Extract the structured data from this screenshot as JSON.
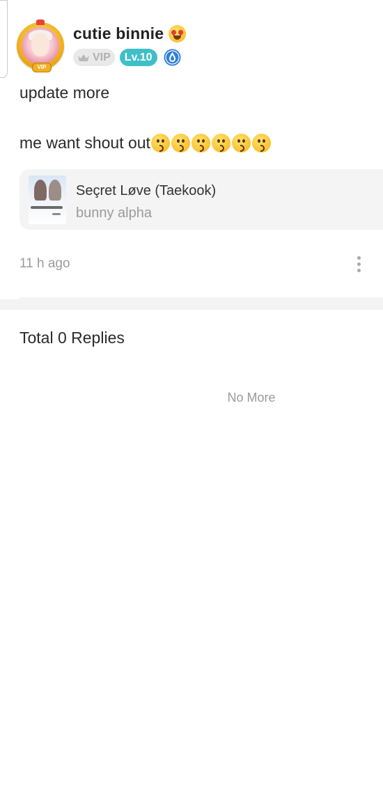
{
  "header": {
    "username": "cutie binnie",
    "vip_label": "VIP",
    "level_label": "Lv.10",
    "avatar_tag": "VIP"
  },
  "post": {
    "line1": "update more",
    "line2": "me want shout out",
    "kiss_emoji_count": 6
  },
  "shared_story": {
    "title": "Seçret Løve (Taekook)",
    "author": "bunny alpha"
  },
  "meta": {
    "time_ago": "11 h ago"
  },
  "replies": {
    "title": "Total 0 Replies",
    "end_label": "No More"
  },
  "colors": {
    "level_badge": "#40bfc8",
    "vip_badge_bg": "#e9e9e9",
    "card_bg": "#f4f4f4",
    "muted_text": "#9a9a9a",
    "curator_badge": "#2f7fd8"
  },
  "icons": {
    "emoji_after_name": "heart-eyes-emoji-icon",
    "kiss_emoji": "kissing-face-emoji-icon",
    "vip_badge": "crown-icon",
    "curator_badge": "curator-drop-icon",
    "more_menu": "vertical-dots-icon"
  }
}
